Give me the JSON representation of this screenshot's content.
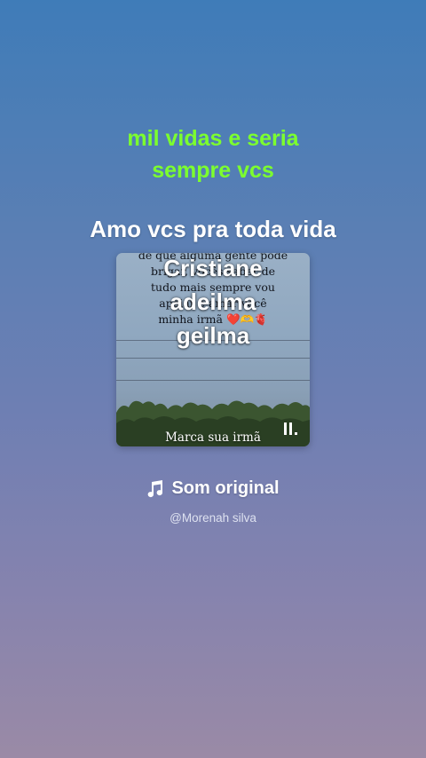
{
  "caption": {
    "line1": "mil vidas e seria",
    "line2": "sempre vcs",
    "color": "#7cff2e"
  },
  "headline": "Amo vcs pra toda vida",
  "card": {
    "poem_lines": [
      "de que alguma gente pode",
      "brigar, vocês saber de",
      "tudo mais sempre vou",
      "apoiar e amar você",
      "minha irmã ❤️🫶🫀"
    ],
    "footer": "Marca sua irmã",
    "control_icon": "pause-icon"
  },
  "names": [
    "Cristiane",
    "adeilma",
    "geilma"
  ],
  "sound": {
    "icon": "music-note-icon",
    "title": "Som original",
    "author": "@Morenah silva"
  }
}
